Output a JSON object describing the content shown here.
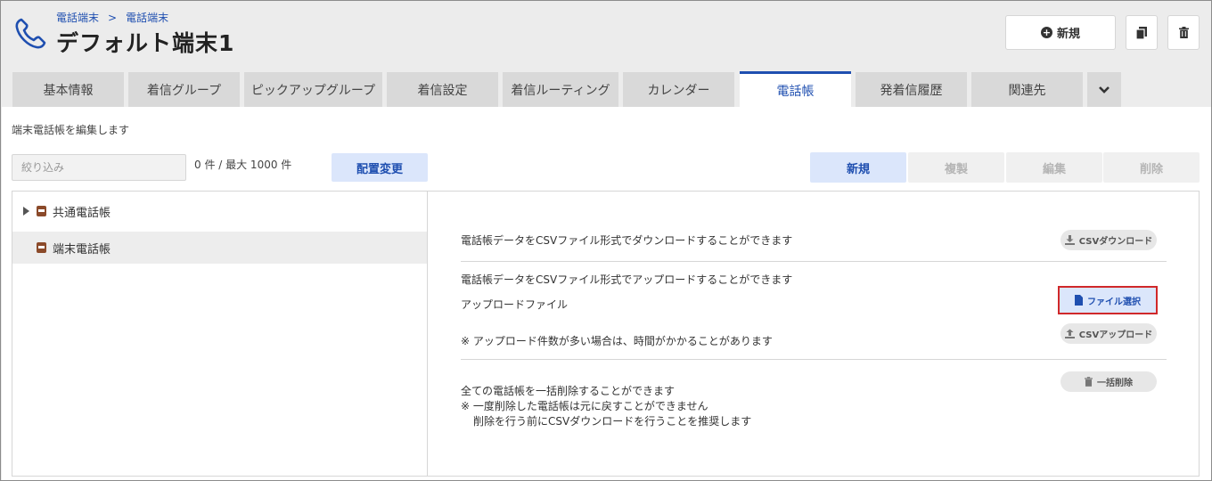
{
  "breadcrumb": {
    "items": [
      "電話端末",
      "電話端末"
    ],
    "separator": ">"
  },
  "title": "デフォルト端末1",
  "header_buttons": {
    "new_label": "新規"
  },
  "tabs": [
    {
      "label": "基本情報",
      "active": false
    },
    {
      "label": "着信グループ",
      "active": false
    },
    {
      "label": "ピックアップグループ",
      "active": false
    },
    {
      "label": "着信設定",
      "active": false
    },
    {
      "label": "着信ルーティング",
      "active": false
    },
    {
      "label": "カレンダー",
      "active": false
    },
    {
      "label": "電話帳",
      "active": true
    },
    {
      "label": "発着信履歴",
      "active": false
    },
    {
      "label": "関連先",
      "active": false
    }
  ],
  "description": "端末電話帳を編集します",
  "filter": {
    "placeholder": "絞り込み",
    "value": ""
  },
  "count_text": "0 件 / 最大 1000 件",
  "rearrange_label": "配置変更",
  "actions": {
    "new": "新規",
    "copy": "複製",
    "edit": "編集",
    "delete": "削除"
  },
  "tree": [
    {
      "label": "共通電話帳",
      "expandable": true,
      "selected": false
    },
    {
      "label": "端末電話帳",
      "expandable": false,
      "selected": true
    }
  ],
  "panel": {
    "download_text": "電話帳データをCSVファイル形式でダウンロードすることができます",
    "download_button": "CSVダウンロード",
    "upload_text": "電話帳データをCSVファイル形式でアップロードすることができます",
    "upload_file_label": "アップロードファイル",
    "file_select_button": "ファイル選択",
    "upload_note": "※ アップロード件数が多い場合は、時間がかかることがあります",
    "upload_button": "CSVアップロード",
    "bulk_delete_text": "全ての電話帳を一括削除することができます",
    "bulk_delete_note1": "※ 一度削除した電話帳は元に戻すことができません",
    "bulk_delete_note2": "削除を行う前にCSVダウンロードを行うことを推奨します",
    "bulk_delete_button": "一括削除"
  },
  "colors": {
    "accent": "#1f4fb0",
    "highlight_border": "#d0282a",
    "book": "#8b4a2a"
  }
}
